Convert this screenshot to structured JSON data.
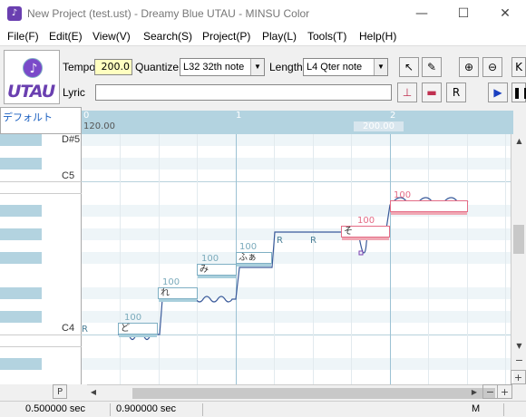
{
  "window": {
    "title": "New Project (test.ust) - Dreamy Blue UTAU - MINSU Color",
    "app_icon_glyph": "♪",
    "controls": {
      "minimize": "—",
      "maximize": "☐",
      "close": "✕"
    }
  },
  "menu": [
    "File(F)",
    "Edit(E)",
    "View(V)",
    "Search(S)",
    "Project(P)",
    "Play(L)",
    "Tools(T)",
    "Help(H)"
  ],
  "logo": {
    "glyph": "♪",
    "text": "UTAU",
    "accent": "#6a3fb0"
  },
  "toolbar": {
    "tempo_label": "Tempo",
    "tempo_value": "200.0",
    "quantize_label": "Quantize",
    "quantize_value": "L32 32th note",
    "length_label": "Length",
    "length_value": "L4  Qter note",
    "lyric_label": "Lyric",
    "lyric_value": "",
    "icons": [
      "pointer-icon",
      "pencil-icon",
      "zoom-in-icon",
      "zoom-out-icon",
      "insert-note-icon",
      "add-note-icon",
      "add-rest-icon",
      "play-icon",
      "pause-icon"
    ]
  },
  "editor": {
    "track_name": "デフォルト",
    "bar_numbers": [
      "0",
      "1",
      "2"
    ],
    "tempo_marks": [
      "120.00",
      "200.00"
    ],
    "key_labels": [
      {
        "name": "D#5"
      },
      {
        "name": "C5"
      },
      {
        "name": "C4"
      }
    ],
    "notes": [
      {
        "lyric": "ど",
        "velocity": "100",
        "color": "blue"
      },
      {
        "lyric": "れ",
        "velocity": "100",
        "color": "blue"
      },
      {
        "lyric": "み",
        "velocity": "100",
        "color": "blue"
      },
      {
        "lyric": "ふぁ",
        "velocity": "100",
        "color": "blue"
      },
      {
        "lyric": "そ",
        "velocity": "100",
        "color": "pink"
      },
      {
        "lyric": "",
        "velocity": "100",
        "color": "pink"
      }
    ],
    "rests": [
      "R",
      "R",
      "R"
    ]
  },
  "bottom_buttons": {
    "p": "P",
    "left": "◀",
    "right": "▶",
    "minus": "−",
    "plus": "+"
  },
  "status": {
    "time1": "0.500000 sec",
    "time2": "0.900000 sec",
    "mode": "M"
  },
  "colors": {
    "accent_blue": "#b3d3e0",
    "note_pink": "#e46c86",
    "brand_purple": "#6a3fb0"
  }
}
